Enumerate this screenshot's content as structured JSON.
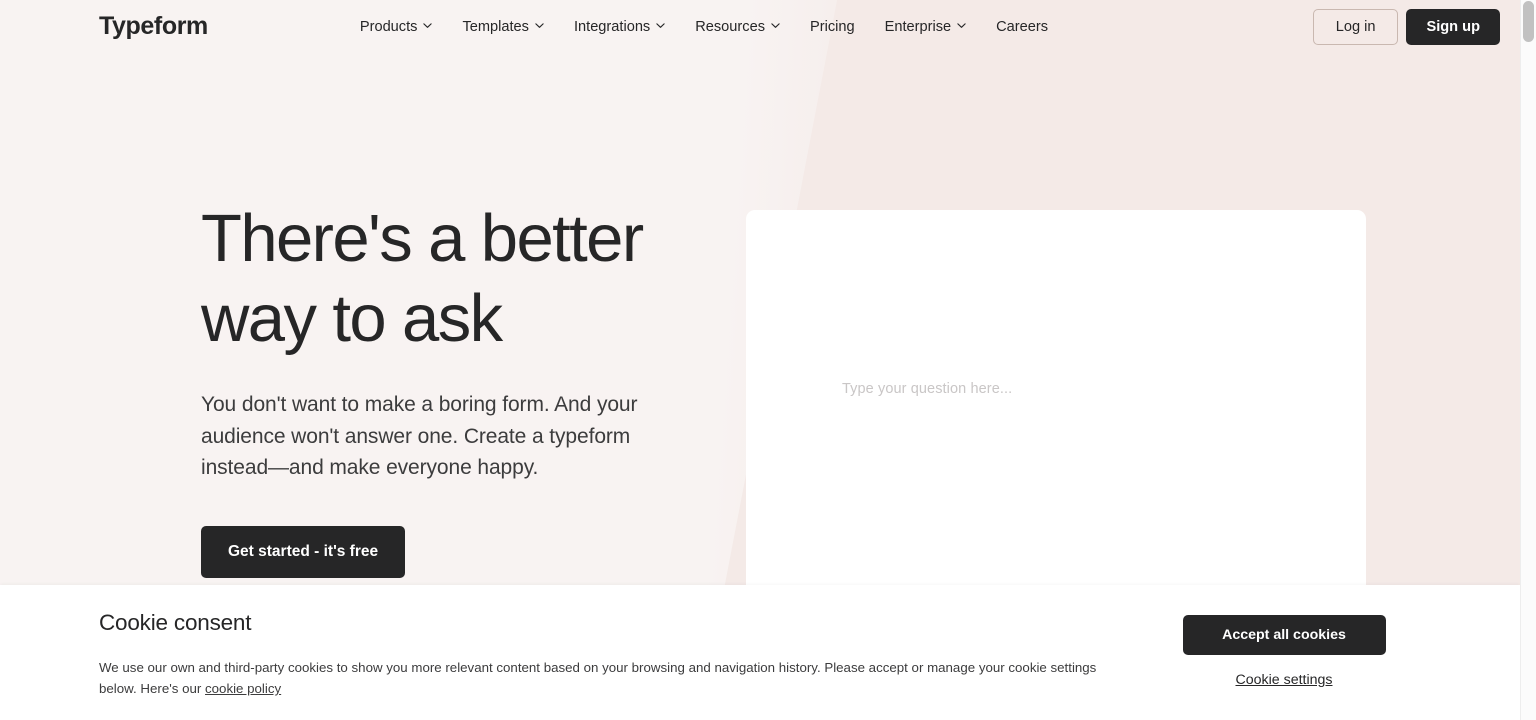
{
  "navbar": {
    "logo": "Typeform",
    "links": [
      {
        "label": "Products",
        "has_dropdown": true,
        "icon": "chevron-down-icon"
      },
      {
        "label": "Templates",
        "has_dropdown": true,
        "icon": "chevron-down-icon"
      },
      {
        "label": "Integrations",
        "has_dropdown": true,
        "icon": "chevron-down-icon"
      },
      {
        "label": "Resources",
        "has_dropdown": true,
        "icon": "chevron-down-icon"
      },
      {
        "label": "Pricing",
        "has_dropdown": false,
        "icon": ""
      },
      {
        "label": "Enterprise",
        "has_dropdown": true,
        "icon": "chevron-down-icon"
      },
      {
        "label": "Careers",
        "has_dropdown": false,
        "icon": ""
      }
    ],
    "login_label": "Log in",
    "signup_label": "Sign up"
  },
  "hero": {
    "title_line1": "There's a better",
    "title_line2": "way to ask",
    "subtitle": "You don't want to make a boring form. And your audience won't answer one. Create a typeform instead—and make everyone happy.",
    "cta_label": "Get started - it's free",
    "card_placeholder": "Type your question here..."
  },
  "cookie": {
    "title": "Cookie consent",
    "body_before_link": "We use our own and third-party cookies to show you more relevant content based on your browsing and navigation history. Please accept or manage your cookie settings below. Here's our ",
    "link_label": "cookie policy",
    "accept_label": "Accept all cookies",
    "settings_label": "Cookie settings"
  },
  "colors": {
    "bg_left": "#f8f3f2",
    "bg_right": "#f4eae7",
    "dark": "#262627",
    "card": "#ffffff",
    "placeholder": "#c9c6c6",
    "login_border": "#c9b8b0"
  }
}
